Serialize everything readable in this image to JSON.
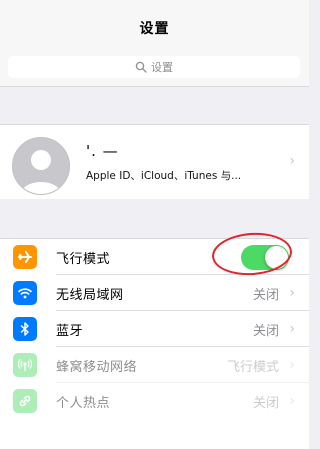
{
  "nav": {
    "title": "设置"
  },
  "search": {
    "placeholder": "设置"
  },
  "profile": {
    "name": "'. —",
    "subtitle": "Apple ID、iCloud、iTunes 与..."
  },
  "colors": {
    "toggle_on": "#4cd964",
    "airplane": "#ff9500",
    "wifi": "#007aff",
    "bluetooth": "#007aff",
    "cellular": "#4cd964",
    "hotspot": "#4cd964",
    "annotation": "#e0262c"
  },
  "settings": {
    "items": [
      {
        "icon": "airplane-icon",
        "label": "飞行模式",
        "toggle_on": true
      },
      {
        "icon": "wifi-icon",
        "label": "无线局域网",
        "value": "关闭"
      },
      {
        "icon": "bluetooth-icon",
        "label": "蓝牙",
        "value": "关闭"
      },
      {
        "icon": "cellular-icon",
        "label": "蜂窝移动网络",
        "value": "飞行模式"
      },
      {
        "icon": "hotspot-icon",
        "label": "个人热点",
        "value": "关闭"
      }
    ]
  }
}
